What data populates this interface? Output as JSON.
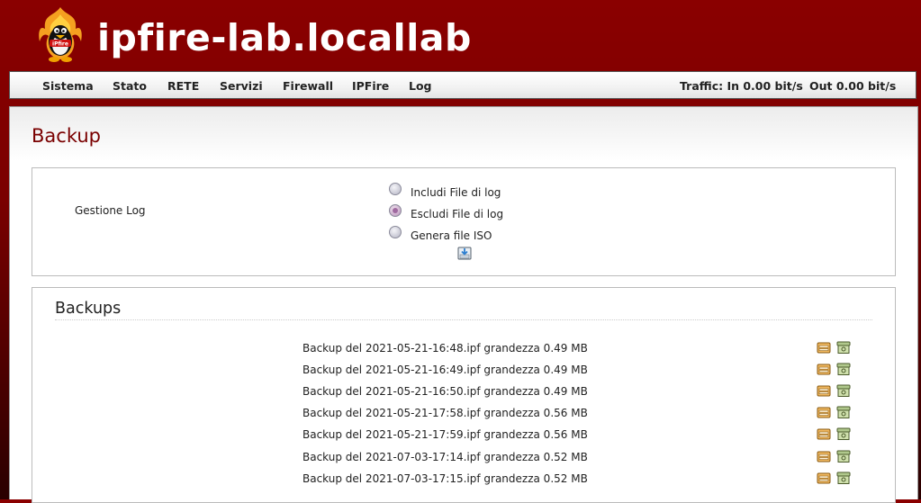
{
  "header": {
    "host": "ipfire-lab.locallab"
  },
  "nav": {
    "items": [
      "Sistema",
      "Stato",
      "RETE",
      "Servizi",
      "Firewall",
      "IPFire",
      "Log"
    ],
    "traffic_in": "Traffic: In 0.00 bit/s",
    "traffic_out": "Out 0.00 bit/s"
  },
  "page": {
    "title": "Backup",
    "log_box": {
      "label": "Gestione Log",
      "options": [
        {
          "label": "Includi File di log",
          "checked": false
        },
        {
          "label": "Escludi File di log",
          "checked": true
        },
        {
          "label": "Genera file ISO",
          "checked": false
        }
      ]
    },
    "backups": {
      "title": "Backups",
      "items": [
        "Backup del 2021-05-21-16:48.ipf grandezza 0.49 MB",
        "Backup del 2021-05-21-16:49.ipf grandezza 0.49 MB",
        "Backup del 2021-05-21-16:50.ipf grandezza 0.49 MB",
        "Backup del 2021-05-21-17:58.ipf grandezza 0.56 MB",
        "Backup del 2021-05-21-17:59.ipf grandezza 0.56 MB",
        "Backup del 2021-07-03-17:14.ipf grandezza 0.52 MB",
        "Backup del 2021-07-03-17:15.ipf grandezza 0.52 MB"
      ]
    }
  },
  "icons": {
    "logo": "ipfire-tux-flame-logo",
    "save": "save-backup-icon",
    "download": "download-icon",
    "restore": "restore-icon"
  }
}
